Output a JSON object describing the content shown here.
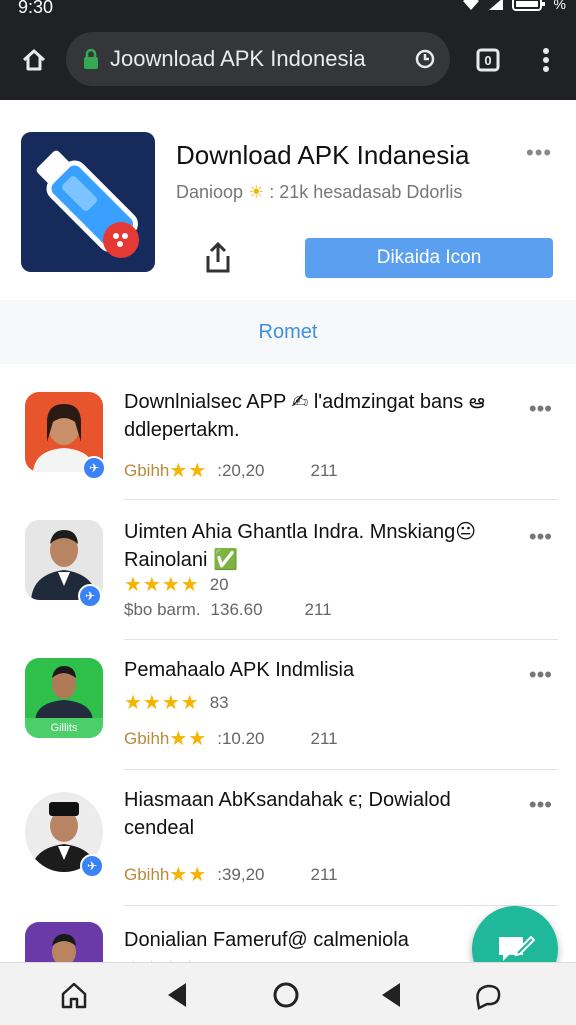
{
  "status_bar": {
    "time": "9:30",
    "battery": "%"
  },
  "browser": {
    "url": "Joownload APK Indonesia"
  },
  "app": {
    "title": "Download APK Indanesia",
    "subtitle_left": "Danioop",
    "subtitle_right": ": 21k hesadasab Ddorlis",
    "install_label": "Dikaida Icon",
    "more": "•••",
    "tab_label": "Romet"
  },
  "colors": {
    "accent": "#5a9ff0",
    "fab": "#1fb89a",
    "star": "#f5b400",
    "toolbar": "#202124"
  },
  "list": [
    {
      "title": "Downlnialsec APP ✍ l'admzingat bans ఆ ddlepertakm.",
      "stars_line": "",
      "meta_left": "Gbihh",
      "meta_stars": "★★",
      "meta_value": ":20,20",
      "meta_count": "211"
    },
    {
      "title": "Uimten Ahia Ghantla Indra. Mnskiang😐 Rainolani ✅",
      "stars_line": "★★★★",
      "stars_value": "20",
      "meta_left": "$bo barm.",
      "meta_stars": "",
      "meta_value": "136.60",
      "meta_count": "211"
    },
    {
      "title": "Pemahaalo APK Indmlisia",
      "stars_line": "★★★★",
      "stars_value": "83",
      "meta_left": "Gbihh",
      "meta_stars": "★★",
      "meta_value": ":10.20",
      "meta_count": "211"
    },
    {
      "title": "Hiasmaan AbKsandahak ϵ; Dowialod cendeal",
      "stars_line": "",
      "meta_left": "Gbihh",
      "meta_stars": "★★",
      "meta_value": ":39,20",
      "meta_count": "211"
    },
    {
      "title": "Donialian Fameruf@ calmeniola",
      "stars_line": "★★★★",
      "stars_value": "",
      "meta_left": "",
      "meta_stars": "",
      "meta_value": "",
      "meta_count": ""
    }
  ],
  "avatar3_caption": "Gillits",
  "icons": [
    "home-icon",
    "back-icon",
    "circle-home-icon",
    "back-icon-2",
    "chat-icon",
    "share-icon",
    "lock-icon",
    "tabs-icon",
    "more-vert-icon",
    "clock-icon",
    "edit-message-icon"
  ]
}
